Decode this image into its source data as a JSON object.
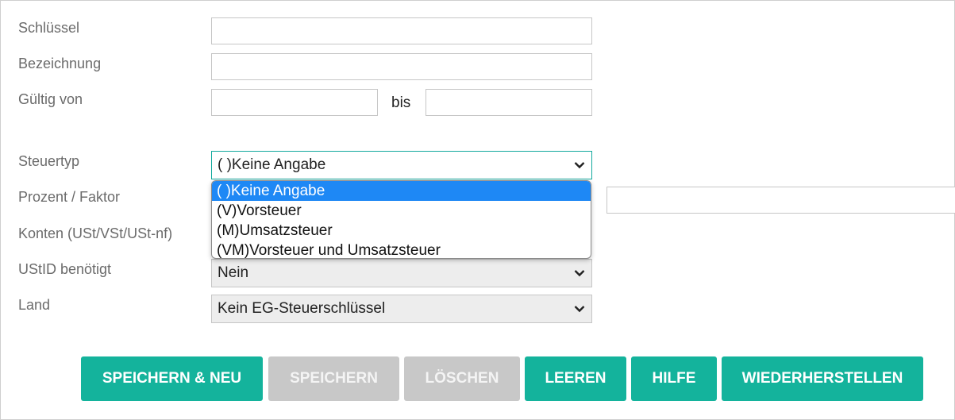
{
  "form": {
    "labels": {
      "schluessel": "Schlüssel",
      "bezeichnung": "Bezeichnung",
      "gueltig_von": "Gültig von",
      "steuertyp": "Steuertyp",
      "prozent": "Prozent / Faktor",
      "konten": "Konten (USt/VSt/USt-nf)",
      "ustid": "UStID benötigt",
      "land": "Land"
    },
    "bis_label": "bis",
    "values": {
      "schluessel": "",
      "bezeichnung": "",
      "gueltig_von": "",
      "gueltig_bis": "",
      "prozent": ""
    },
    "steuertyp_selected": "( )Keine Angabe",
    "steuertyp_options": [
      "( )Keine Angabe",
      "(V)Vorsteuer",
      "(M)Umsatzsteuer",
      "(VM)Vorsteuer und Umsatzsteuer"
    ],
    "ustid_selected": "Nein",
    "land_selected": "Kein EG-Steuerschlüssel"
  },
  "buttons": {
    "save_new": "SPEICHERN & NEU",
    "save": "SPEICHERN",
    "delete": "LÖSCHEN",
    "clear": "LEEREN",
    "help": "HILFE",
    "restore": "WIEDERHERSTELLEN"
  },
  "colors": {
    "accent": "#14b39c",
    "disabled": "#c8c8c8",
    "option_highlight": "#1e88f5",
    "focus_border": "#13a99e"
  },
  "icons": {
    "dropdown": "chevron-down-icon"
  }
}
